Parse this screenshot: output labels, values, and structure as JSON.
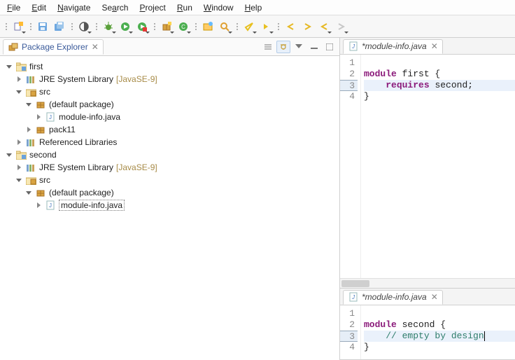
{
  "menu": {
    "file": "File",
    "edit": "Edit",
    "navigate": "Navigate",
    "search": "Search",
    "project": "Project",
    "run": "Run",
    "window": "Window",
    "help": "Help"
  },
  "explorer": {
    "title": "Package Explorer",
    "projects": [
      {
        "name": "first",
        "jre_label": "JRE System Library",
        "jre_decor": "[JavaSE-9]",
        "src": "src",
        "default_pkg": "(default package)",
        "file": "module-info.java",
        "pack": "pack11",
        "reflib": "Referenced Libraries"
      },
      {
        "name": "second",
        "jre_label": "JRE System Library",
        "jre_decor": "[JavaSE-9]",
        "src": "src",
        "default_pkg": "(default package)",
        "file": "module-info.java"
      }
    ]
  },
  "editors": {
    "top": {
      "tab": "*module-info.java",
      "lines": {
        "l1": "",
        "l2": {
          "pre": "module",
          "mid": " first {"
        },
        "l3": {
          "indent": "    ",
          "kw": "requires",
          "rest": " second;"
        },
        "l4": "}"
      }
    },
    "bot": {
      "tab": "*module-info.java",
      "lines": {
        "l1": "",
        "l2": {
          "pre": "module",
          "mid": " second {"
        },
        "l3": {
          "indent": "    ",
          "comment": "// empty by design"
        },
        "l4": "}"
      }
    }
  }
}
